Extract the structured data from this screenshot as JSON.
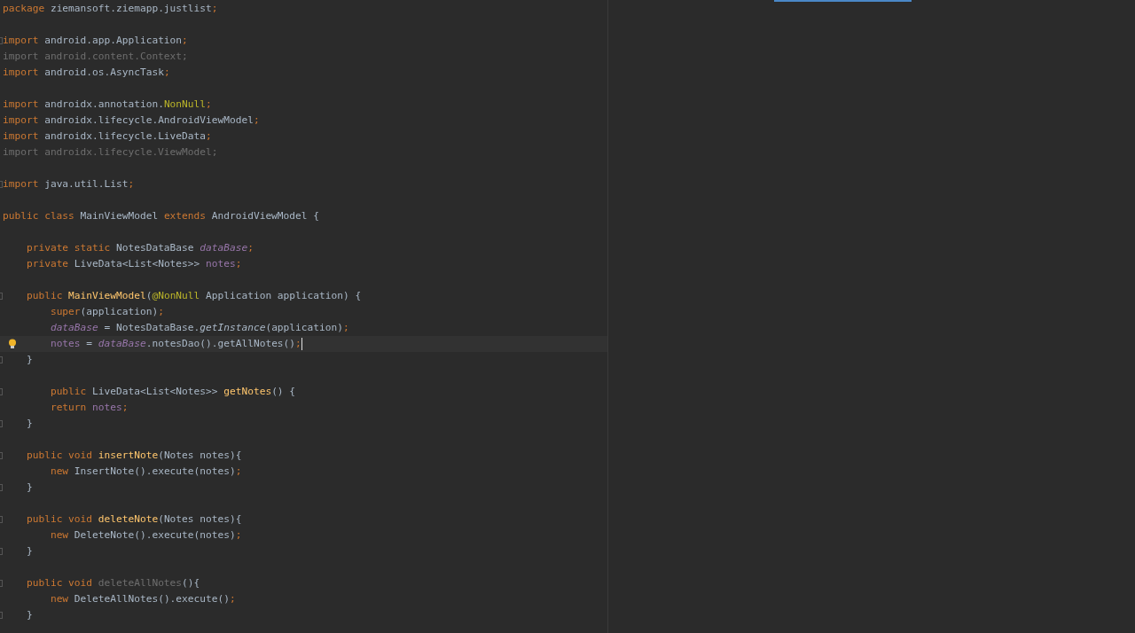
{
  "editor": {
    "lines": [
      {
        "kind": "code",
        "tokens": [
          {
            "kind": "keyword",
            "text": "package"
          },
          {
            "kind": "plain",
            "text": " ziemansoft.ziemapp.justlist"
          },
          {
            "kind": "punct",
            "text": ";"
          }
        ]
      },
      {
        "kind": "blank"
      },
      {
        "kind": "code",
        "fold": true,
        "tokens": [
          {
            "kind": "keyword",
            "text": "import"
          },
          {
            "kind": "plain",
            "text": " android.app.Application"
          },
          {
            "kind": "punct",
            "text": ";"
          }
        ]
      },
      {
        "kind": "code",
        "tokens": [
          {
            "kind": "unused",
            "text": "import android.content.Context;"
          }
        ]
      },
      {
        "kind": "code",
        "tokens": [
          {
            "kind": "keyword",
            "text": "import"
          },
          {
            "kind": "plain",
            "text": " android.os.AsyncTask"
          },
          {
            "kind": "punct",
            "text": ";"
          }
        ]
      },
      {
        "kind": "blank"
      },
      {
        "kind": "code",
        "tokens": [
          {
            "kind": "keyword",
            "text": "import"
          },
          {
            "kind": "plain",
            "text": " androidx.annotation."
          },
          {
            "kind": "annotation",
            "text": "NonNull"
          },
          {
            "kind": "punct",
            "text": ";"
          }
        ]
      },
      {
        "kind": "code",
        "tokens": [
          {
            "kind": "keyword",
            "text": "import"
          },
          {
            "kind": "plain",
            "text": " androidx.lifecycle.AndroidViewModel"
          },
          {
            "kind": "punct",
            "text": ";"
          }
        ]
      },
      {
        "kind": "code",
        "tokens": [
          {
            "kind": "keyword",
            "text": "import"
          },
          {
            "kind": "plain",
            "text": " androidx.lifecycle.LiveData"
          },
          {
            "kind": "punct",
            "text": ";"
          }
        ]
      },
      {
        "kind": "code",
        "tokens": [
          {
            "kind": "unused",
            "text": "import androidx.lifecycle.ViewModel;"
          }
        ]
      },
      {
        "kind": "blank"
      },
      {
        "kind": "code",
        "fold": true,
        "tokens": [
          {
            "kind": "keyword",
            "text": "import"
          },
          {
            "kind": "plain",
            "text": " java.util.List"
          },
          {
            "kind": "punct",
            "text": ";"
          }
        ]
      },
      {
        "kind": "blank"
      },
      {
        "kind": "code",
        "tokens": [
          {
            "kind": "keyword",
            "text": "public class"
          },
          {
            "kind": "plain",
            "text": " MainViewModel "
          },
          {
            "kind": "keyword",
            "text": "extends"
          },
          {
            "kind": "plain",
            "text": " AndroidViewModel {"
          }
        ]
      },
      {
        "kind": "blank"
      },
      {
        "kind": "code",
        "tokens": [
          {
            "kind": "keyword",
            "text": "    private static"
          },
          {
            "kind": "plain",
            "text": " NotesDataBase "
          },
          {
            "kind": "static-field",
            "text": "dataBase"
          },
          {
            "kind": "punct",
            "text": ";"
          }
        ]
      },
      {
        "kind": "code",
        "tokens": [
          {
            "kind": "keyword",
            "text": "    private"
          },
          {
            "kind": "plain",
            "text": " LiveData<List<Notes>> "
          },
          {
            "kind": "field",
            "text": "notes"
          },
          {
            "kind": "punct",
            "text": ";"
          }
        ]
      },
      {
        "kind": "blank"
      },
      {
        "kind": "code",
        "fold": true,
        "tokens": [
          {
            "kind": "keyword",
            "text": "    public "
          },
          {
            "kind": "method",
            "text": "MainViewModel"
          },
          {
            "kind": "plain",
            "text": "("
          },
          {
            "kind": "annotation",
            "text": "@NonNull"
          },
          {
            "kind": "plain",
            "text": " Application application) {"
          }
        ]
      },
      {
        "kind": "code",
        "tokens": [
          {
            "kind": "keyword",
            "text": "        super"
          },
          {
            "kind": "plain",
            "text": "(application)"
          },
          {
            "kind": "punct",
            "text": ";"
          }
        ]
      },
      {
        "kind": "code",
        "tokens": [
          {
            "kind": "static-field",
            "text": "        dataBase"
          },
          {
            "kind": "plain",
            "text": " = NotesDataBase."
          },
          {
            "kind": "static-call",
            "text": "getInstance"
          },
          {
            "kind": "plain",
            "text": "(application)"
          },
          {
            "kind": "punct",
            "text": ";"
          }
        ]
      },
      {
        "kind": "code",
        "current": true,
        "bulb": true,
        "caret": true,
        "tokens": [
          {
            "kind": "field",
            "text": "        notes"
          },
          {
            "kind": "plain",
            "text": " = "
          },
          {
            "kind": "static-field",
            "text": "dataBase"
          },
          {
            "kind": "plain",
            "text": ".notesDao().getAllNotes()"
          },
          {
            "kind": "punct",
            "text": ";"
          }
        ]
      },
      {
        "kind": "code",
        "fold": true,
        "tokens": [
          {
            "kind": "plain",
            "text": "    }"
          }
        ]
      },
      {
        "kind": "blank"
      },
      {
        "kind": "code",
        "fold": true,
        "tokens": [
          {
            "kind": "keyword",
            "text": "        public"
          },
          {
            "kind": "plain",
            "text": " LiveData<List<Notes>> "
          },
          {
            "kind": "method",
            "text": "getNotes"
          },
          {
            "kind": "plain",
            "text": "() {"
          }
        ]
      },
      {
        "kind": "code",
        "tokens": [
          {
            "kind": "keyword",
            "text": "        return "
          },
          {
            "kind": "field",
            "text": "notes"
          },
          {
            "kind": "punct",
            "text": ";"
          }
        ]
      },
      {
        "kind": "code",
        "fold": true,
        "tokens": [
          {
            "kind": "plain",
            "text": "    }"
          }
        ]
      },
      {
        "kind": "blank"
      },
      {
        "kind": "code",
        "fold": true,
        "tokens": [
          {
            "kind": "keyword",
            "text": "    public void "
          },
          {
            "kind": "method",
            "text": "insertNote"
          },
          {
            "kind": "plain",
            "text": "(Notes notes){"
          }
        ]
      },
      {
        "kind": "code",
        "tokens": [
          {
            "kind": "keyword",
            "text": "        new"
          },
          {
            "kind": "plain",
            "text": " InsertNote().execute(notes)"
          },
          {
            "kind": "punct",
            "text": ";"
          }
        ]
      },
      {
        "kind": "code",
        "fold": true,
        "tokens": [
          {
            "kind": "plain",
            "text": "    }"
          }
        ]
      },
      {
        "kind": "blank"
      },
      {
        "kind": "code",
        "fold": true,
        "tokens": [
          {
            "kind": "keyword",
            "text": "    public void "
          },
          {
            "kind": "method",
            "text": "deleteNote"
          },
          {
            "kind": "plain",
            "text": "(Notes notes){"
          }
        ]
      },
      {
        "kind": "code",
        "tokens": [
          {
            "kind": "keyword",
            "text": "        new"
          },
          {
            "kind": "plain",
            "text": " DeleteNote().execute(notes)"
          },
          {
            "kind": "punct",
            "text": ";"
          }
        ]
      },
      {
        "kind": "code",
        "fold": true,
        "tokens": [
          {
            "kind": "plain",
            "text": "    }"
          }
        ]
      },
      {
        "kind": "blank"
      },
      {
        "kind": "code",
        "fold": true,
        "tokens": [
          {
            "kind": "keyword",
            "text": "    public void "
          },
          {
            "kind": "unused",
            "text": "deleteAllNotes"
          },
          {
            "kind": "plain",
            "text": "(){"
          }
        ]
      },
      {
        "kind": "code",
        "tokens": [
          {
            "kind": "keyword",
            "text": "        new"
          },
          {
            "kind": "plain",
            "text": " DeleteAllNotes().execute()"
          },
          {
            "kind": "punct",
            "text": ";"
          }
        ]
      },
      {
        "kind": "code",
        "fold": true,
        "tokens": [
          {
            "kind": "plain",
            "text": "    }"
          }
        ]
      }
    ]
  }
}
